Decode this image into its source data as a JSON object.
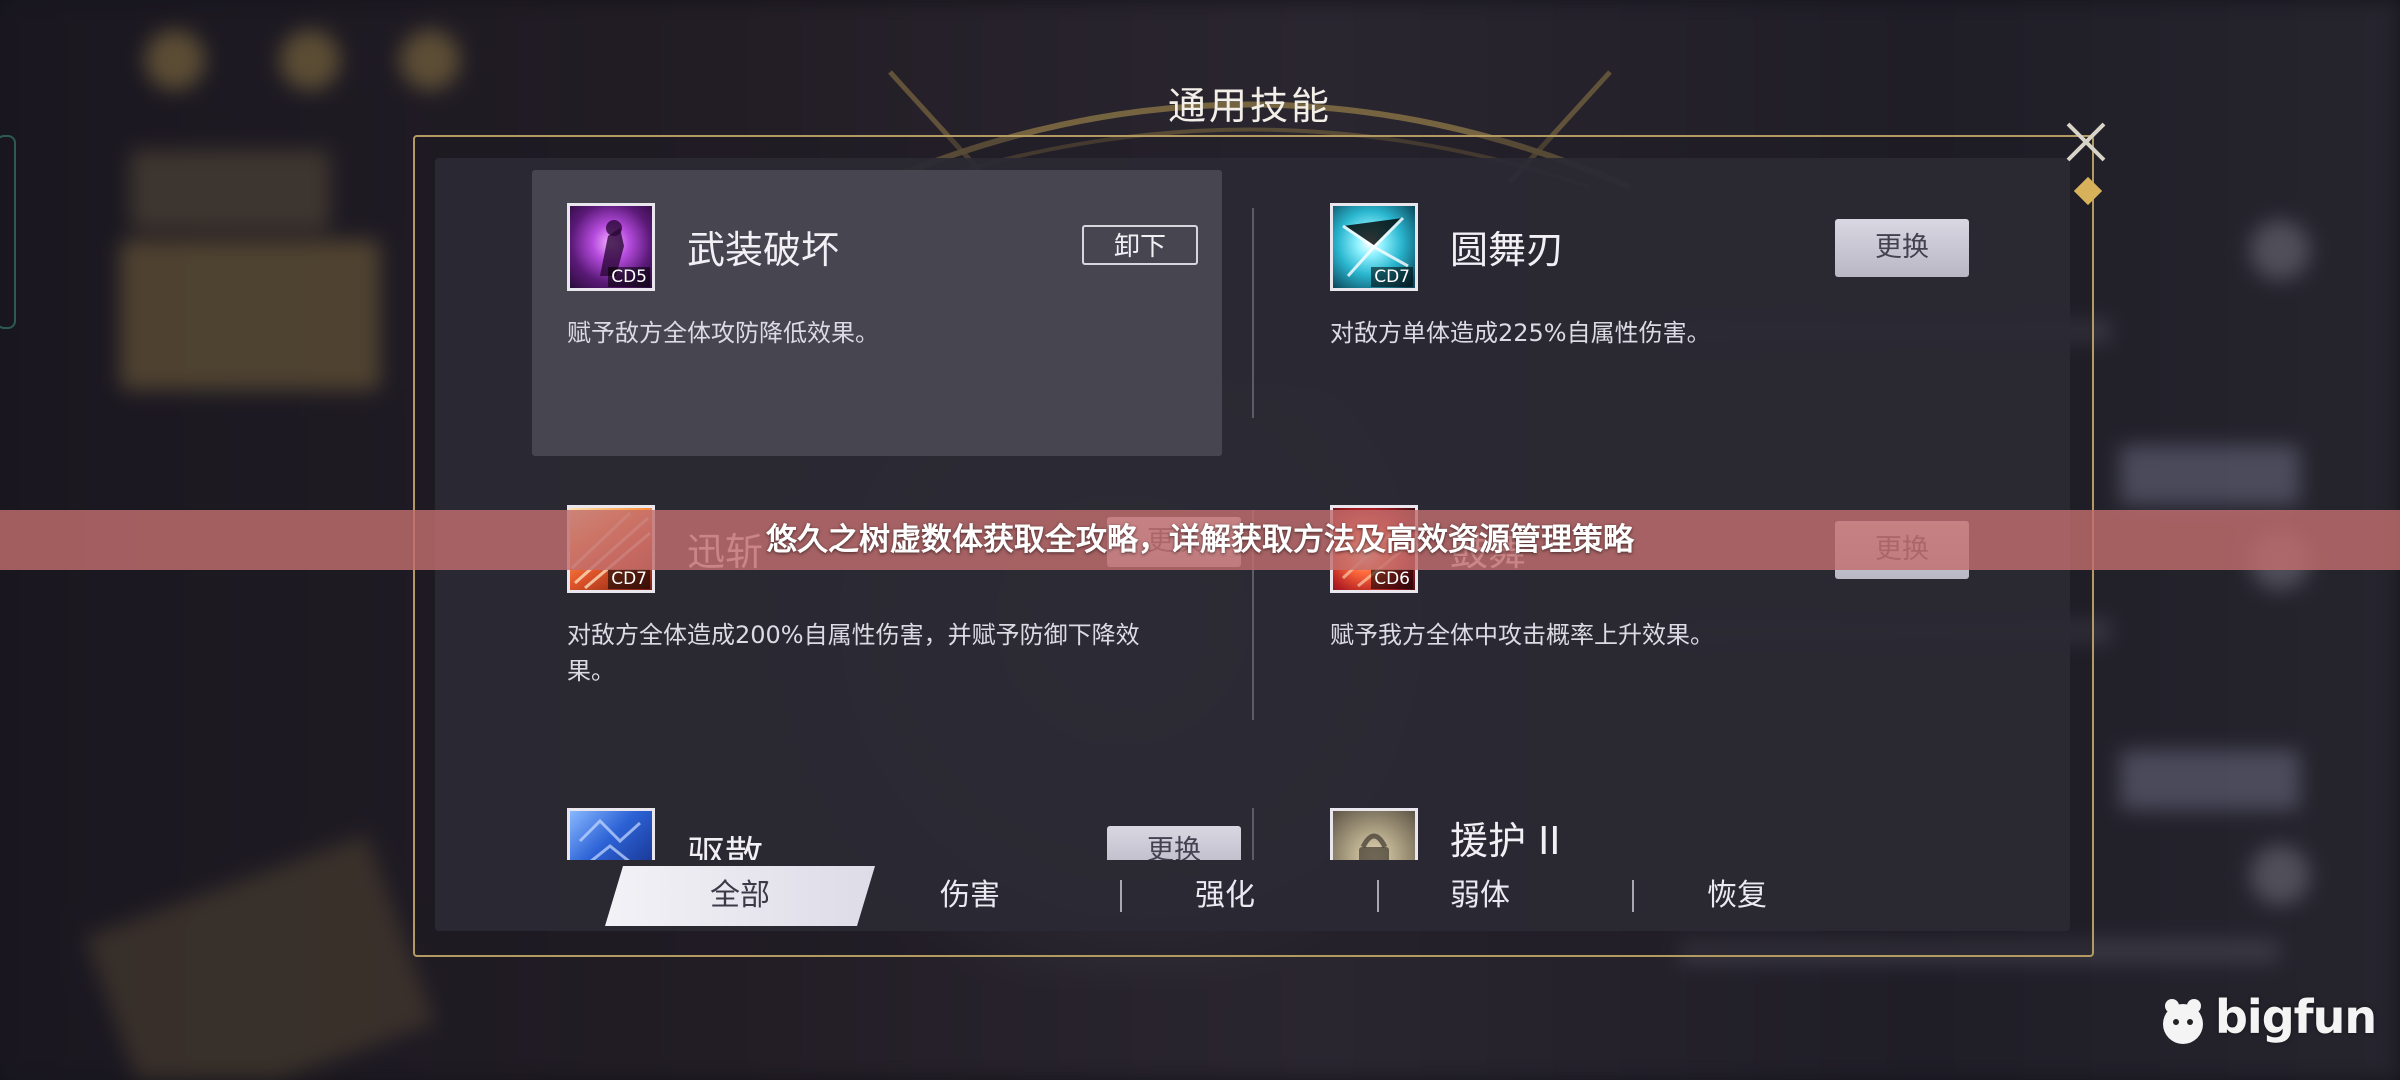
{
  "dialog": {
    "title": "通用技能"
  },
  "skills": [
    {
      "name": "武装破坏",
      "cd": "CD5",
      "desc": "赋予敌方全体攻防降低效果。",
      "action": "卸下",
      "icon": "armor-break-icon"
    },
    {
      "name": "圆舞刃",
      "cd": "CD7",
      "desc": "对敌方单体造成225%自属性伤害。",
      "action": "更换",
      "icon": "round-blade-icon"
    },
    {
      "name": "迅斩",
      "cd": "CD7",
      "desc": "对敌方全体造成200%自属性伤害，并赋予防御下降效果。",
      "action": "更换",
      "icon": "swift-slash-icon"
    },
    {
      "name": "鼓舞",
      "cd": "CD6",
      "desc": "赋予我方全体中攻击概率上升效果。",
      "action": "更换",
      "icon": "inspire-icon"
    },
    {
      "name": "驱散",
      "cd": "",
      "desc": "",
      "action": "更换",
      "icon": "dispel-icon"
    },
    {
      "name": "援护 II",
      "cd": "",
      "desc": "",
      "action": "",
      "icon": "support-icon"
    }
  ],
  "tabs": [
    {
      "label": "全部",
      "active": true
    },
    {
      "label": "伤害",
      "active": false
    },
    {
      "label": "强化",
      "active": false
    },
    {
      "label": "弱体",
      "active": false
    },
    {
      "label": "恢复",
      "active": false
    }
  ],
  "banner": {
    "text": "悠久之树虚数体获取全攻略，详解获取方法及高效资源管理策略"
  },
  "watermark": {
    "text": "bigfun"
  },
  "colors": {
    "accent_gold": "#b39a63",
    "banner": "#c16e6e",
    "panel": "#2b2a34"
  }
}
